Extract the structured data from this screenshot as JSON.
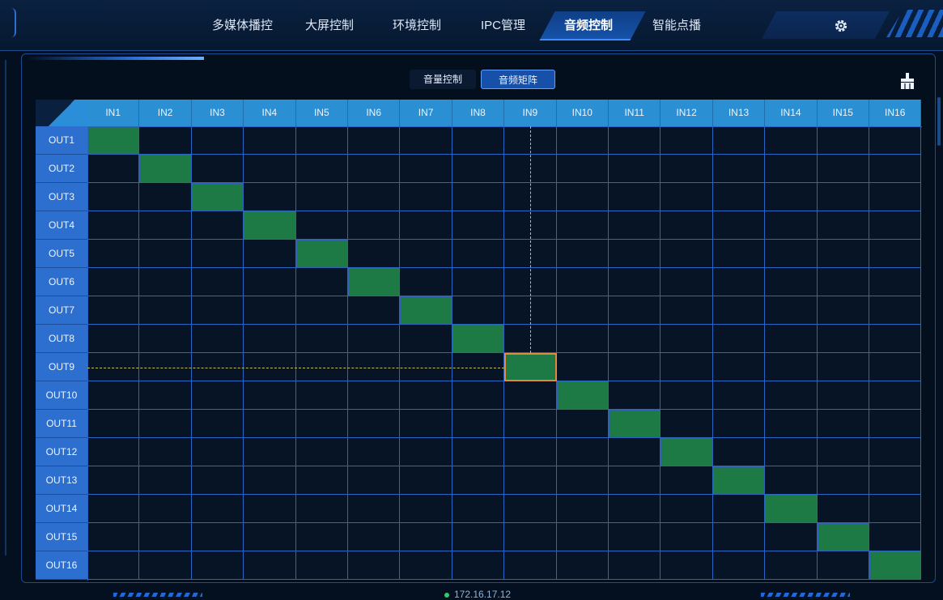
{
  "nav": {
    "items": [
      {
        "label": "多媒体播控",
        "active": false
      },
      {
        "label": "大屏控制",
        "active": false
      },
      {
        "label": "环境控制",
        "active": false
      },
      {
        "label": "IPC管理",
        "active": false
      },
      {
        "label": "音频控制",
        "active": true
      },
      {
        "label": "智能点播",
        "active": false
      }
    ],
    "settings_icon": "gear-icon"
  },
  "tabs": [
    {
      "label": "音量控制",
      "active": false
    },
    {
      "label": "音频矩阵",
      "active": true
    }
  ],
  "toolbar": {
    "clear_icon": "brush-icon"
  },
  "matrix": {
    "inputs": [
      "IN1",
      "IN2",
      "IN3",
      "IN4",
      "IN5",
      "IN6",
      "IN7",
      "IN8",
      "IN9",
      "IN10",
      "IN11",
      "IN12",
      "IN13",
      "IN14",
      "IN15",
      "IN16"
    ],
    "outputs": [
      "OUT1",
      "OUT2",
      "OUT3",
      "OUT4",
      "OUT5",
      "OUT6",
      "OUT7",
      "OUT8",
      "OUT9",
      "OUT10",
      "OUT11",
      "OUT12",
      "OUT13",
      "OUT14",
      "OUT15",
      "OUT16"
    ],
    "routes": [
      [
        1,
        1
      ],
      [
        2,
        2
      ],
      [
        3,
        3
      ],
      [
        4,
        4
      ],
      [
        5,
        5
      ],
      [
        6,
        6
      ],
      [
        7,
        7
      ],
      [
        8,
        8
      ],
      [
        9,
        9
      ],
      [
        10,
        10
      ],
      [
        11,
        11
      ],
      [
        12,
        12
      ],
      [
        13,
        13
      ],
      [
        14,
        14
      ],
      [
        15,
        15
      ],
      [
        16,
        16
      ]
    ],
    "selected": {
      "out": 9,
      "in": 9
    }
  },
  "status": {
    "ip": "172.16.17.12"
  },
  "colors": {
    "accent": "#1650a8",
    "route_on": "#1e7a44",
    "selected_outline": "#e08a3c",
    "header": "#2b8fd4"
  }
}
